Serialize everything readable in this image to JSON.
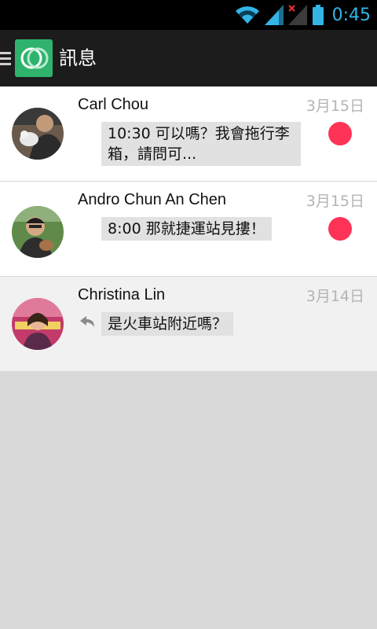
{
  "status_bar": {
    "time": "0:45",
    "icons": [
      "wifi-icon",
      "signal-icon",
      "signal-no-data-icon",
      "battery-icon"
    ],
    "accent_color": "#33b5e5"
  },
  "action_bar": {
    "title": "訊息",
    "icons": [
      "menu-icon",
      "app-logo"
    ],
    "logo_color": "#2fb36c"
  },
  "conversations": [
    {
      "name": "Carl Chou",
      "date": "3月15日",
      "preview": "10:30 可以嗎？我會拖行李箱，請問可...",
      "unread": true,
      "replied": false
    },
    {
      "name": "Andro Chun An Chen",
      "date": "3月15日",
      "preview": "8:00 那就捷運站見摟！",
      "unread": true,
      "replied": false
    },
    {
      "name": "Christina Lin",
      "date": "3月14日",
      "preview": "是火車站附近嗎？",
      "unread": false,
      "replied": true
    }
  ],
  "colors": {
    "unread_dot": "#ff3355",
    "read_row_bg": "#f1f1f1",
    "bubble_bg": "#e1e1e1"
  }
}
